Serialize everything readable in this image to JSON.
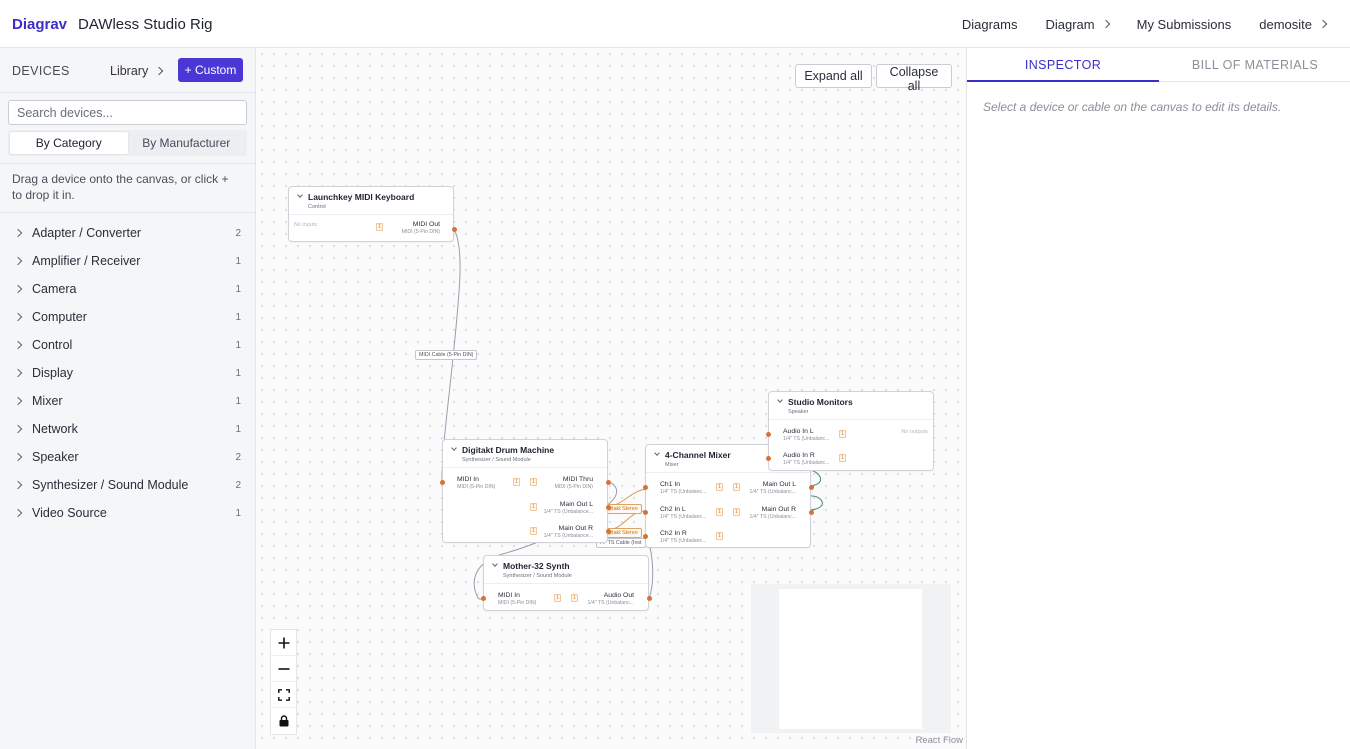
{
  "app": {
    "brand": "Diagrav",
    "title": "DAWless Studio Rig"
  },
  "nav": {
    "diagrams": "Diagrams",
    "diagram": "Diagram",
    "submissions": "My Submissions",
    "user": "demosite"
  },
  "sidebar": {
    "title": "DEVICES",
    "library": "Library",
    "custom_button": "+ Custom",
    "search_placeholder": "Search devices...",
    "modes": [
      "By Category",
      "By Manufacturer"
    ],
    "active_mode": "By Category",
    "hint": "Drag a device onto the canvas, or click + to drop it in.",
    "categories": [
      {
        "label": "Adapter / Converter",
        "count": "2"
      },
      {
        "label": "Amplifier / Receiver",
        "count": "1"
      },
      {
        "label": "Camera",
        "count": "1"
      },
      {
        "label": "Computer",
        "count": "1"
      },
      {
        "label": "Control",
        "count": "1"
      },
      {
        "label": "Display",
        "count": "1"
      },
      {
        "label": "Mixer",
        "count": "1"
      },
      {
        "label": "Network",
        "count": "1"
      },
      {
        "label": "Speaker",
        "count": "2"
      },
      {
        "label": "Synthesizer / Sound Module",
        "count": "2"
      },
      {
        "label": "Video Source",
        "count": "1"
      }
    ]
  },
  "canvas": {
    "expand_all": "Expand all",
    "collapse_all": "Collapse all",
    "attribution": "React Flow",
    "nodes": {
      "keyboard": {
        "title": "Launchkey MIDI Keyboard",
        "category": "Control",
        "no_inputs": "No inputs",
        "outputs": [
          {
            "name": "MIDI Out",
            "type": "MIDI (5-Pin DIN)",
            "qty": "1"
          }
        ]
      },
      "drum": {
        "title": "Digitakt Drum Machine",
        "category": "Synthesizer / Sound Module",
        "inputs": [
          {
            "name": "MIDI In",
            "type": "MIDI (5-Pin DIN)",
            "qty": "1"
          }
        ],
        "outputs": [
          {
            "name": "MIDI Thru",
            "type": "MIDI (5-Pin DIN)",
            "qty": "1"
          },
          {
            "name": "Main Out L",
            "type": "1/4\" TS (Unbalance...",
            "qty": "1"
          },
          {
            "name": "Main Out R",
            "type": "1/4\" TS (Unbalance...",
            "qty": "1"
          }
        ]
      },
      "mixer": {
        "title": "4-Channel Mixer",
        "category": "Mixer",
        "inputs": [
          {
            "name": "Ch1 In",
            "type": "1/4\" TS (Unbalanc...",
            "qty": "1"
          },
          {
            "name": "Ch2 In L",
            "type": "1/4\" TS (Unbalanc...",
            "qty": "1"
          },
          {
            "name": "Ch2 In R",
            "type": "1/4\" TS (Unbalanc...",
            "qty": "1"
          }
        ],
        "outputs": [
          {
            "name": "Main Out L",
            "type": "1/4\" TS (Unbalanc...",
            "qty": "1"
          },
          {
            "name": "Main Out R",
            "type": "1/4\" TS (Unbalanc...",
            "qty": "1"
          }
        ]
      },
      "monitors": {
        "title": "Studio Monitors",
        "category": "Speaker",
        "no_outputs": "No outputs",
        "inputs": [
          {
            "name": "Audio In L",
            "type": "1/4\" TS (Unbalanc...",
            "qty": "1"
          },
          {
            "name": "Audio In R",
            "type": "1/4\" TS (Unbalanc...",
            "qty": "1"
          }
        ]
      },
      "mother": {
        "title": "Mother-32 Synth",
        "category": "Synthesizer / Sound Module",
        "inputs": [
          {
            "name": "MIDI In",
            "type": "MIDI (5-Pin DIN)",
            "qty": "1"
          }
        ],
        "outputs": [
          {
            "name": "Audio Out",
            "type": "1/4\" TS (Unbalanc...",
            "qty": "1"
          }
        ]
      }
    },
    "edge_labels": {
      "midi": "MIDI Cable (5-Pin DIN)",
      "stereo_a": "gitakt Stereo",
      "stereo_b": "gitakt Stereo",
      "ts_cable": "/4\" TS Cable (Inst"
    },
    "colors": {
      "accent": "#4b36d6",
      "handle": "#d0743c",
      "audio_edge": "#4a8a66",
      "midi_edge": "#9a9cae",
      "stereo_edge": "#d99a4e"
    }
  },
  "inspector": {
    "tabs": [
      "INSPECTOR",
      "BILL OF MATERIALS"
    ],
    "active_tab": "INSPECTOR",
    "empty": "Select a device or cable on the canvas to edit its details."
  }
}
